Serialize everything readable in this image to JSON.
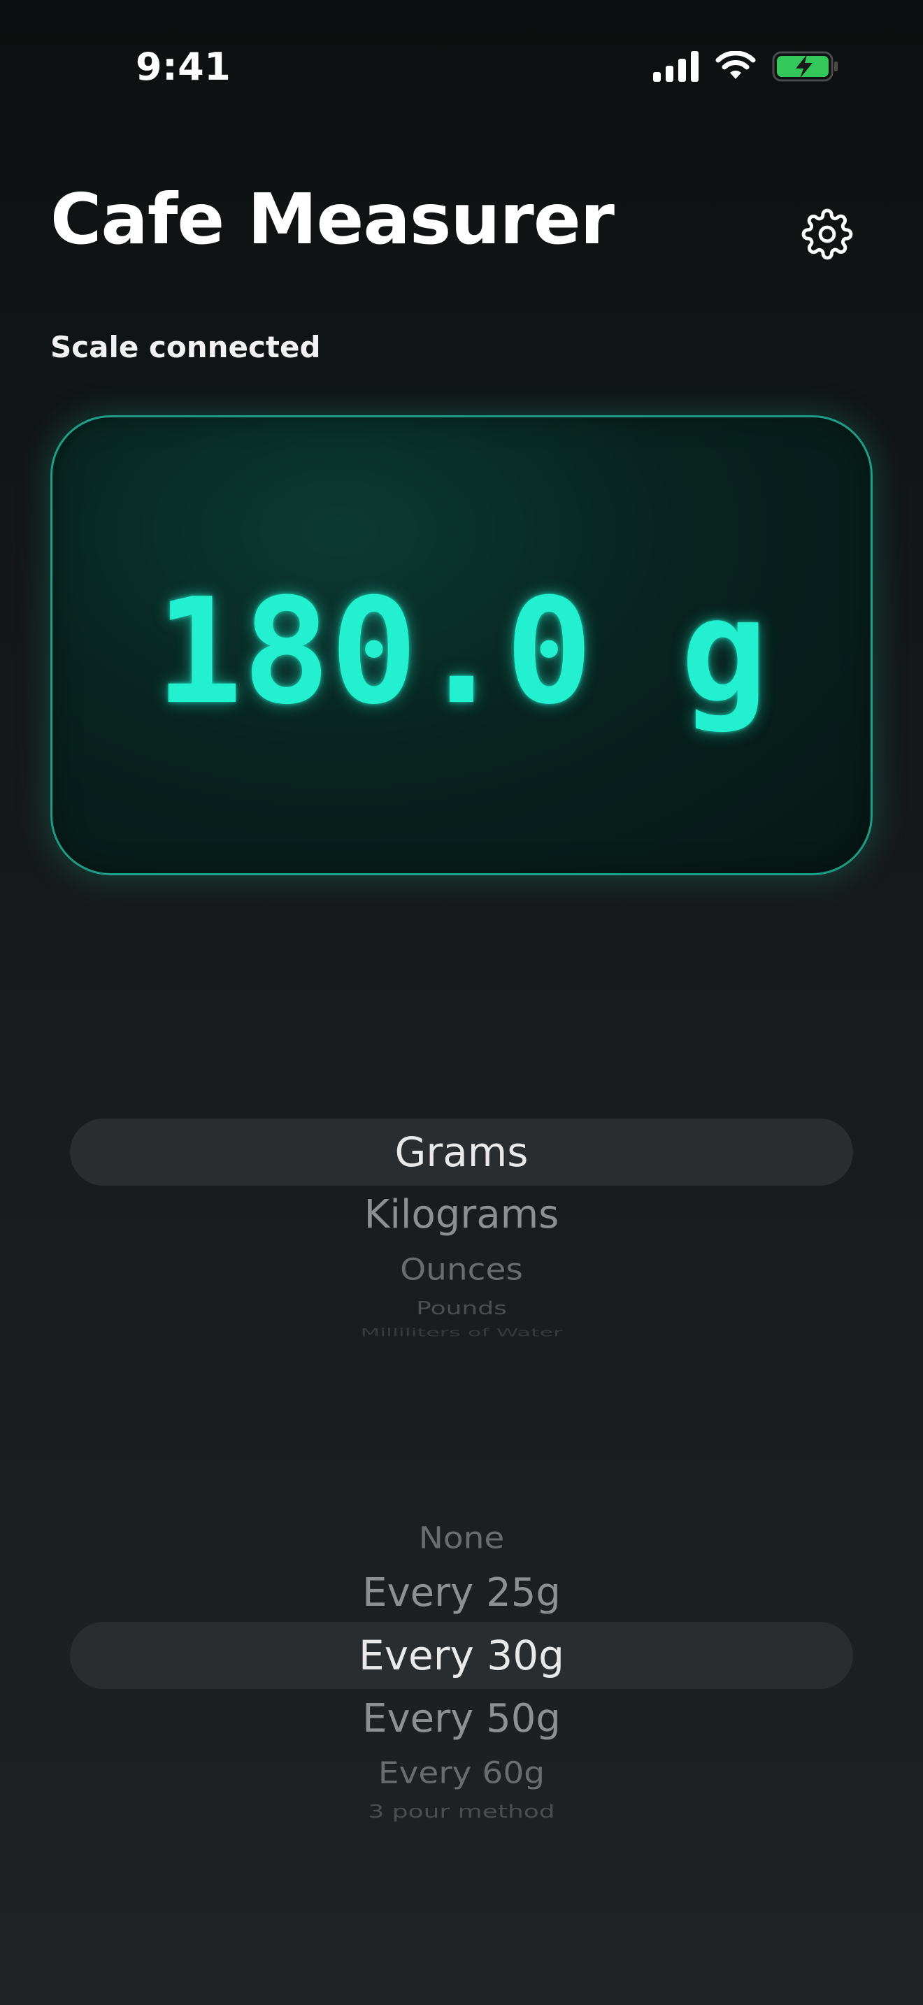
{
  "status_bar": {
    "time": "9:41",
    "icons": [
      "cellular-signal-icon",
      "wifi-icon",
      "battery-charging-icon"
    ],
    "battery_color": "#34c759"
  },
  "header": {
    "title": "Cafe Measurer",
    "settings_icon": "gear-icon"
  },
  "scale": {
    "status": "Scale connected",
    "reading": "180.0 g",
    "display_color": "#22f0cf"
  },
  "unit_picker": {
    "items": [
      "Grams",
      "Kilograms",
      "Ounces",
      "Pounds",
      "Milliliters of Water"
    ],
    "selected": "Grams"
  },
  "interval_picker": {
    "items": [
      "None",
      "Every 25g",
      "Every 30g",
      "Every 50g",
      "Every 60g",
      "3 pour method"
    ],
    "selected": "Every 30g"
  }
}
